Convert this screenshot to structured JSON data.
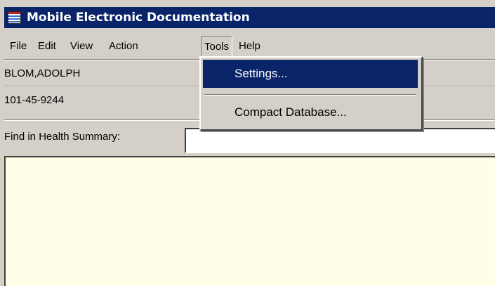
{
  "window": {
    "title": "Mobile Electronic Documentation",
    "icon": "app-document-icon"
  },
  "menubar": {
    "items": [
      {
        "label": "File"
      },
      {
        "label": "Edit"
      },
      {
        "label": "View"
      },
      {
        "label": "Action"
      },
      {
        "label": "Tools"
      },
      {
        "label": "Help"
      }
    ],
    "open_menu": "Tools"
  },
  "patient": {
    "name": "BLOM,ADOLPH",
    "id": "101-45-9244"
  },
  "search": {
    "label": "Find in Health Summary:",
    "value": "",
    "placeholder": ""
  },
  "tools_menu": {
    "items": [
      {
        "label": "Settings..."
      },
      {
        "label": "Compact Database..."
      }
    ],
    "selected": "Settings..."
  },
  "colors": {
    "titlebar": "#0a246a",
    "menu_highlight": "#0a246a",
    "face": "#d4d0c8",
    "summary_background": "#fffee6"
  }
}
